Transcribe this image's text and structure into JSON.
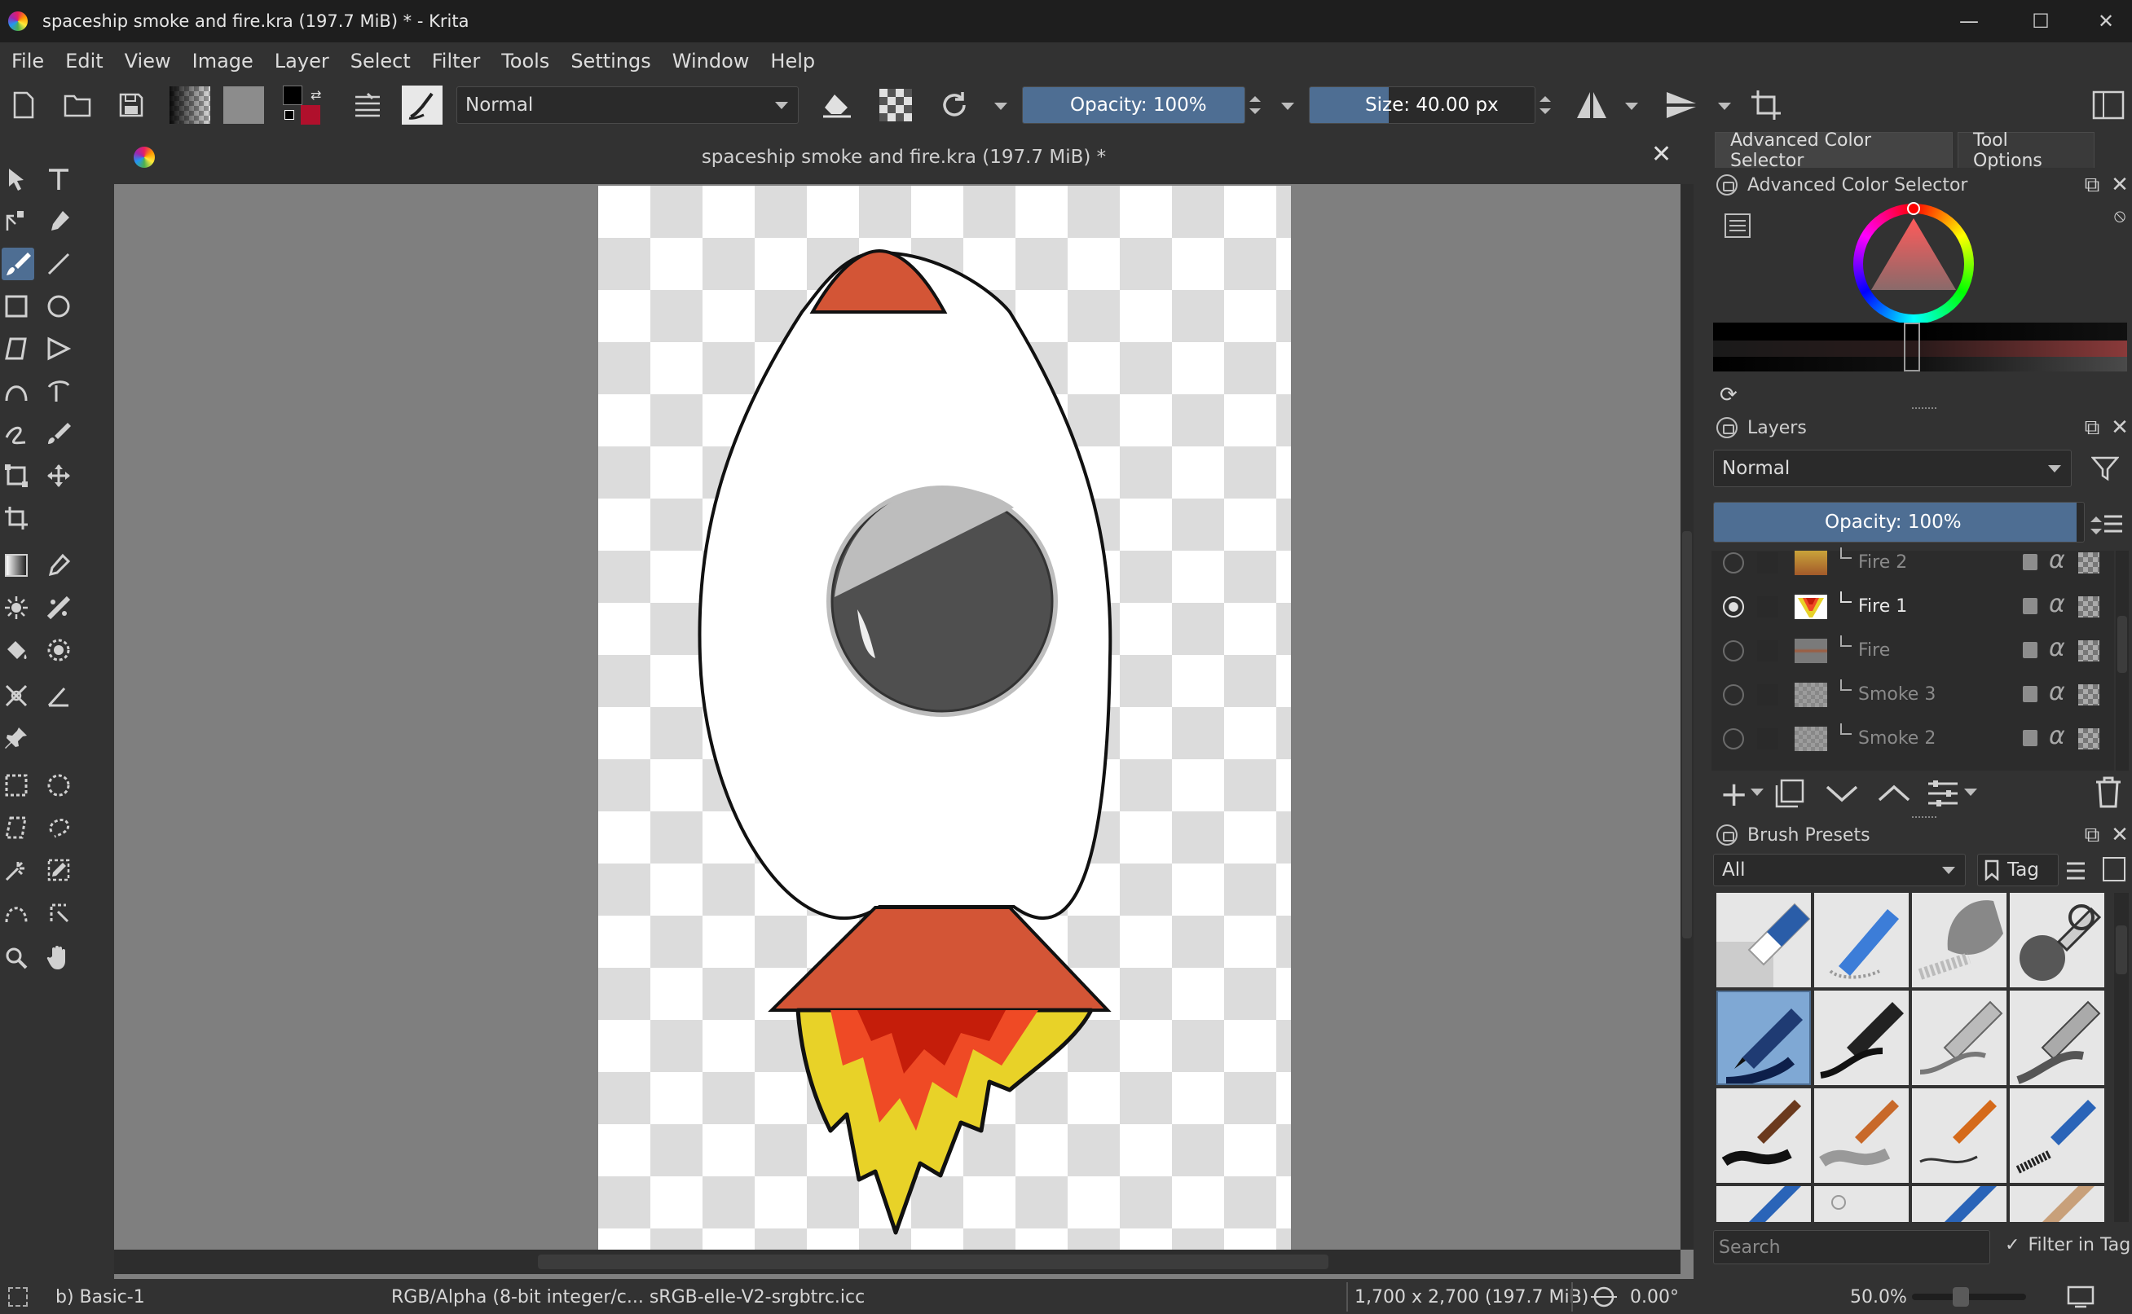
{
  "window": {
    "title": "spaceship smoke and fire.kra (197.7 MiB) * - Krita",
    "minimize": "—",
    "maximize": "☐",
    "close": "✕"
  },
  "menu": [
    "File",
    "Edit",
    "View",
    "Image",
    "Layer",
    "Select",
    "Filter",
    "Tools",
    "Settings",
    "Window",
    "Help"
  ],
  "toolbar": {
    "blend_mode": "Normal",
    "opacity": "Opacity: 100%",
    "opacity_value": 1.0,
    "size": "Size: 40.00 px",
    "size_fill": 0.35
  },
  "document": {
    "tab_title": "spaceship smoke and fire.kra (197.7 MiB) *",
    "close": "✕"
  },
  "dock": {
    "tabs": [
      "Advanced Color Selector",
      "Tool Options"
    ],
    "color_selector_title": "Advanced Color Selector",
    "layers_title": "Layers",
    "layers_blend": "Normal",
    "layers_opacity": "Opacity:  100%",
    "layers": [
      {
        "name": "Fire 2",
        "visible": false
      },
      {
        "name": "Fire 1",
        "visible": true
      },
      {
        "name": "Fire",
        "visible": false
      },
      {
        "name": "Smoke 3",
        "visible": false
      },
      {
        "name": "Smoke 2",
        "visible": false
      }
    ],
    "brush_presets_title": "Brush Presets",
    "brush_filter": "All",
    "tag_label": "Tag",
    "search_placeholder": "Search",
    "filter_in_tag": "Filter in Tag"
  },
  "status": {
    "brush": "b) Basic-1",
    "color_space": "RGB/Alpha (8-bit integer/c...  sRGB-elle-V2-srgbtrc.icc",
    "dimensions": "1,700 x 2,700 (197.7 MiB)",
    "rotation": "0.00°",
    "zoom": "50.0%"
  },
  "colors": {
    "accent": "#4e6e93",
    "rocket_red": "#d35536",
    "flame_yellow": "#e8d228",
    "flame_orange": "#ef4a25",
    "flame_dark": "#c51d0a",
    "window_dark": "#4f4f4f",
    "window_light": "#bdbdbd"
  }
}
